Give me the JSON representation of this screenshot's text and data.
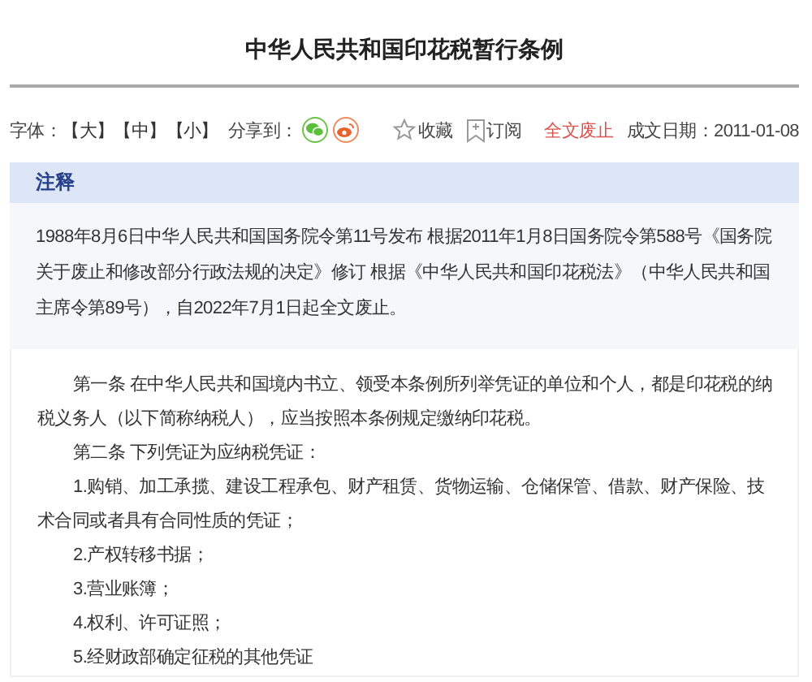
{
  "title": "中华人民共和国印花税暂行条例",
  "toolbar": {
    "font_label": "字体：",
    "font_sizes": [
      "【大】",
      "【中】",
      "【小】"
    ],
    "share_label": "分享到：",
    "favorite": "收藏",
    "subscribe": "订阅",
    "status": "全文废止",
    "date": "成文日期：2011-01-08"
  },
  "note": {
    "heading": "注释",
    "text": "1988年8月6日中华人民共和国国务院令第11号发布 根据2011年1月8日国务院令第588号《国务院关于废止和修改部分行政法规的决定》修订 根据《中华人民共和国印花税法》（中华人民共和国主席令第89号），自2022年7月1日起全文废止。"
  },
  "articles": [
    "第一条 在中华人民共和国境内书立、领受本条例所列举凭证的单位和个人，都是印花税的纳税义务人（以下简称纳税人），应当按照本条例规定缴纳印花税。",
    "第二条 下列凭证为应纳税凭证：",
    "1.购销、加工承揽、建设工程承包、财产租赁、货物运输、仓储保管、借款、财产保险、技术合同或者具有合同性质的凭证；",
    "2.产权转移书据；",
    "3.营业账簿；",
    "4.权利、许可证照；",
    "5.经财政部确定征税的其他凭证"
  ]
}
